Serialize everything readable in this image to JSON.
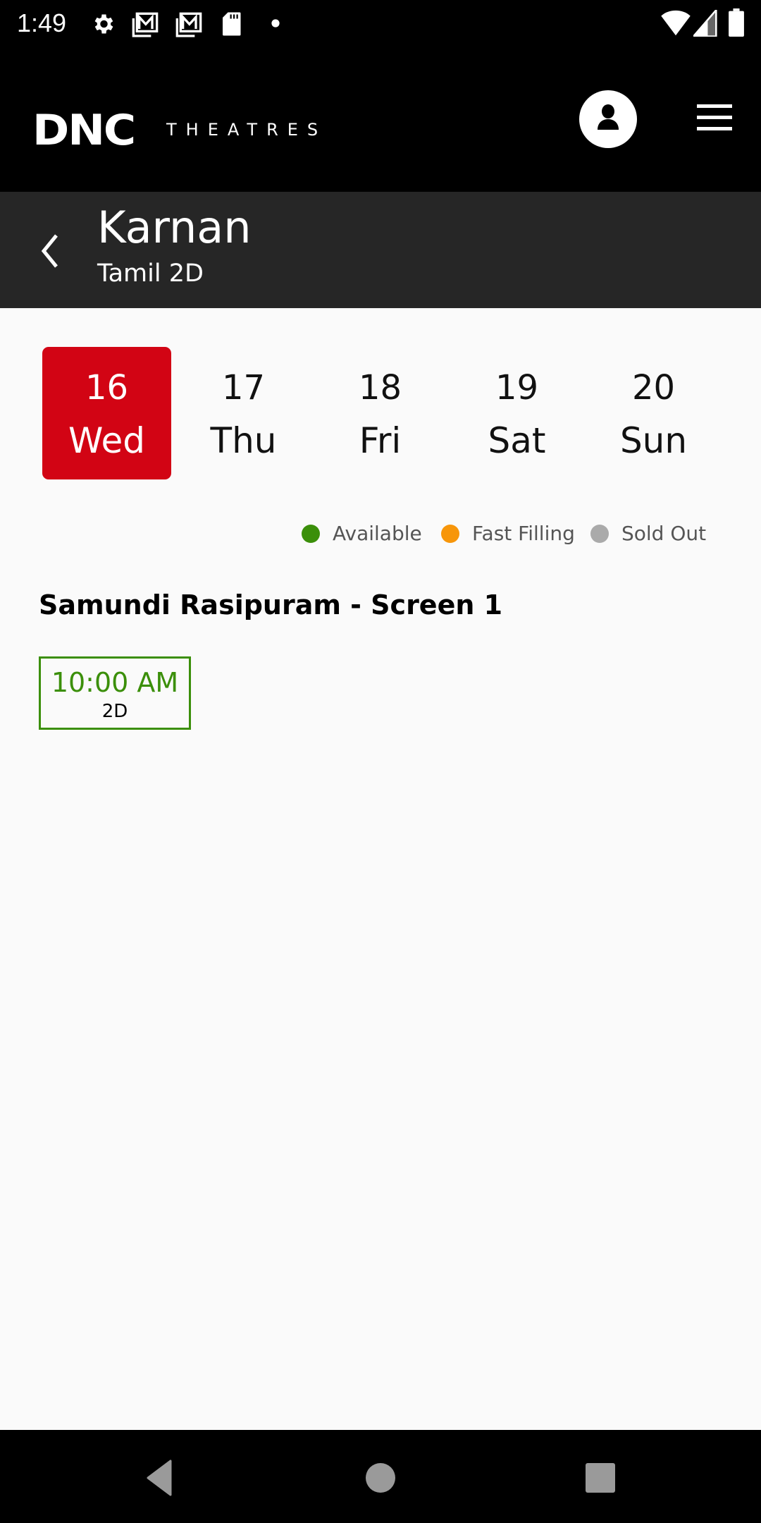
{
  "status_bar": {
    "time": "1:49",
    "left_icons": [
      "settings-icon",
      "gmail-icon",
      "gmail-icon",
      "sd-card-icon",
      "dot-icon"
    ],
    "right_icons": [
      "wifi-icon",
      "signal-icon",
      "battery-icon"
    ]
  },
  "header": {
    "logo_primary": "DNC",
    "logo_secondary": "THEATRES",
    "profile_icon": "account-icon",
    "menu_icon": "hamburger-menu-icon"
  },
  "movie": {
    "title": "Karnan",
    "subtitle": "Tamil 2D",
    "back_icon": "chevron-left-icon"
  },
  "dates": [
    {
      "num": "16",
      "day": "Wed",
      "selected": true
    },
    {
      "num": "17",
      "day": "Thu",
      "selected": false
    },
    {
      "num": "18",
      "day": "Fri",
      "selected": false
    },
    {
      "num": "19",
      "day": "Sat",
      "selected": false
    },
    {
      "num": "20",
      "day": "Sun",
      "selected": false
    }
  ],
  "legend": [
    {
      "label": "Available",
      "color": "#3b8f0a"
    },
    {
      "label": "Fast Filling",
      "color": "#f7960a"
    },
    {
      "label": "Sold Out",
      "color": "#aaaaaa"
    }
  ],
  "colors": {
    "accent": "#d20414",
    "available": "#3b8f0a"
  },
  "venues": [
    {
      "name": "Samundi Rasipuram - Screen 1",
      "showtimes": [
        {
          "time": "10:00 AM",
          "format": "2D",
          "status": "Available"
        }
      ]
    }
  ],
  "nav_bar": {
    "icons": [
      "back-triangle-icon",
      "home-circle-icon",
      "recents-square-icon"
    ]
  }
}
